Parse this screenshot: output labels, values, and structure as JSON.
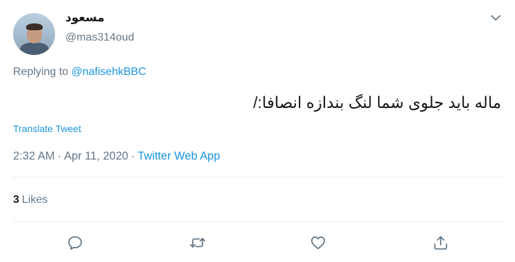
{
  "user": {
    "display_name": "مسعود",
    "handle": "@mas314oud"
  },
  "reply": {
    "prefix": "Replying to",
    "mention": "@nafisehkBBC"
  },
  "tweet": {
    "text": "ماله باید جلوی شما لنگ بندازه انصافا:/",
    "translate_label": "Translate Tweet",
    "time": "2:32 AM",
    "separator": "·",
    "date": "Apr 11, 2020",
    "source": "Twitter Web App"
  },
  "stats": {
    "likes_count": "3",
    "likes_label": "Likes"
  },
  "icons": {
    "more": "chevron-down-icon",
    "reply": "speech-bubble-icon",
    "retweet": "retweet-icon",
    "like": "heart-icon",
    "share": "share-icon"
  },
  "colors": {
    "link": "#1b95e0",
    "secondary_text": "#657786",
    "primary_text": "#14171a",
    "divider": "#e6ecf0"
  }
}
